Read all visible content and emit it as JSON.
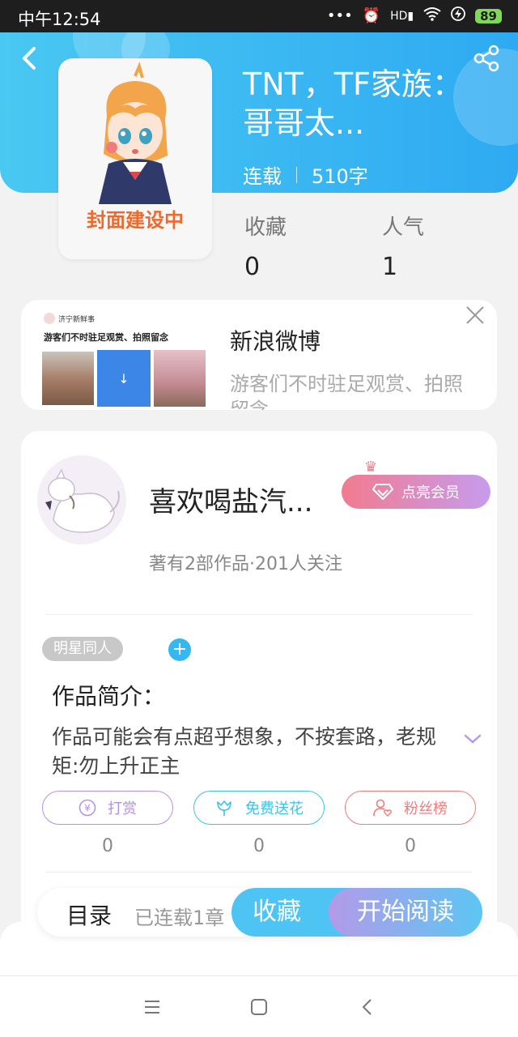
{
  "status_bar": {
    "time": "中午12:54",
    "battery": "89",
    "icons": [
      "more-dots-icon",
      "alarm-icon",
      "hd-signal-icon",
      "wifi-icon",
      "charging-icon",
      "battery-icon"
    ]
  },
  "header": {
    "back_icon": "chevron-left-icon",
    "share_icon": "share-icon"
  },
  "book": {
    "cover_text": "封面建设中",
    "title": "TNT，TF家族：哥哥太...",
    "status": "连载",
    "word_count": "510字",
    "stats": [
      {
        "label": "收藏",
        "value": "0"
      },
      {
        "label": "人气",
        "value": "1"
      }
    ]
  },
  "ad": {
    "thumb_source": "济宁新鲜事",
    "thumb_caption": "游客们不时驻足观赏、拍照留念",
    "title": "新浪微博",
    "description": "游客们不时驻足观赏、拍照留念"
  },
  "author": {
    "name": "喜欢喝盐汽...",
    "vip_label": "点亮会员",
    "stats": "著有2部作品·201人关注"
  },
  "tags": [
    "明星同人"
  ],
  "intro": {
    "title": "作品简介：",
    "text": "作品可能会有点超乎想象，不按套路，老规矩:勿上升正主"
  },
  "actions": [
    {
      "label": "打赏",
      "count": "0",
      "color": "#b491e6",
      "icon": "yen-icon"
    },
    {
      "label": "免费送花",
      "count": "0",
      "color": "#3fc2e8",
      "icon": "flower-icon"
    },
    {
      "label": "粉丝榜",
      "count": "0",
      "color": "#ef7c7c",
      "icon": "fan-heart-icon"
    }
  ],
  "bottom_bar": {
    "toc_label": "目录",
    "toc_info": "已连载1章",
    "collect_label": "收藏",
    "read_label": "开始阅读"
  },
  "colors": {
    "header_blue": "#2eaaf2",
    "accent_blue": "#35b8f2",
    "vip_pink": "#f27b8f",
    "vip_purple": "#c79bee"
  }
}
